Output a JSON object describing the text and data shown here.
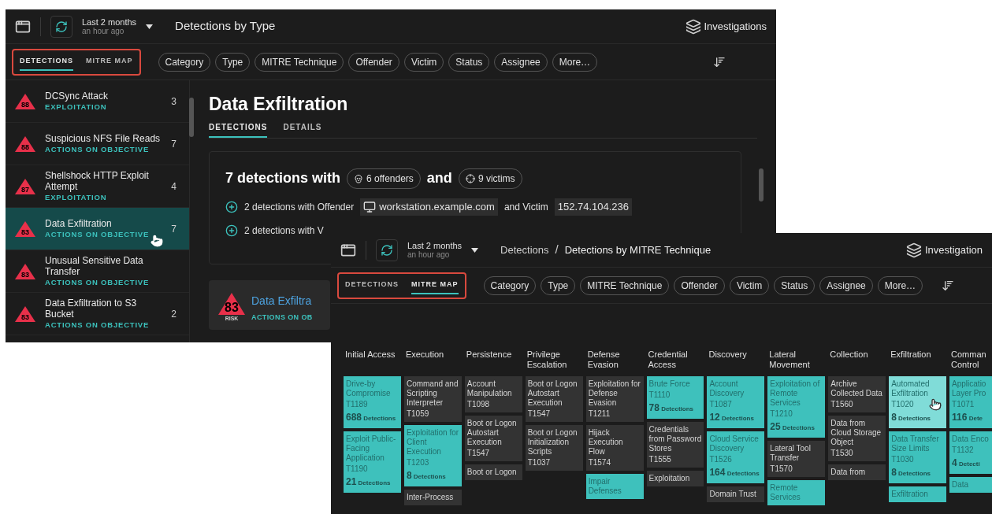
{
  "detections_window": {
    "time_range": {
      "label": "Last 2 months",
      "updated": "an hour ago"
    },
    "title": "Detections by Type",
    "header_link": "Investigations",
    "view_tabs": [
      {
        "label": "DETECTIONS",
        "selected": true
      },
      {
        "label": "MITRE MAP",
        "selected": false
      }
    ],
    "filters": [
      "Category",
      "Type",
      "MITRE Technique",
      "Offender",
      "Victim",
      "Status",
      "Assignee",
      "More…"
    ],
    "sidebar": {
      "items": [
        {
          "name": "DCSync Attack",
          "category": "EXPLOITATION",
          "risk": "88",
          "count": "3",
          "selected": false,
          "pointer": false
        },
        {
          "name": "Suspicious NFS File Reads",
          "category": "ACTIONS ON OBJECTIVE",
          "risk": "88",
          "count": "7",
          "selected": false,
          "pointer": false
        },
        {
          "name": "Shellshock HTTP Exploit Attempt",
          "category": "EXPLOITATION",
          "risk": "87",
          "count": "4",
          "selected": false,
          "pointer": false
        },
        {
          "name": "Data Exfiltration",
          "category": "ACTIONS ON OBJECTIVE",
          "risk": "83",
          "count": "7",
          "selected": true,
          "pointer": true
        },
        {
          "name": "Unusual Sensitive Data Transfer",
          "category": "ACTIONS ON OBJECTIVE",
          "risk": "83",
          "selected": false,
          "pointer": false
        },
        {
          "name": "Data Exfiltration to S3 Bucket",
          "category": "ACTIONS ON OBJECTIVE",
          "risk": "83",
          "count": "2",
          "selected": false,
          "pointer": false
        }
      ]
    },
    "detail": {
      "title": "Data Exfiltration",
      "tabs": [
        {
          "label": "DETECTIONS",
          "selected": true
        },
        {
          "label": "DETAILS",
          "selected": false
        }
      ],
      "summary": {
        "lead": "7 detections with",
        "offenders": "6 offenders",
        "joiner": "and",
        "victims": "9 victims"
      },
      "groups": [
        {
          "prefix": "2 detections with Offender",
          "offender": "workstation.example.com",
          "joiner": "and Victim",
          "victim": "152.74.104.236"
        },
        {
          "prefix": "2 detections with V"
        }
      ],
      "card": {
        "risk": "83",
        "risk_label": "RISK",
        "title": "Data Exfiltra",
        "category": "ACTIONS ON OB"
      }
    }
  },
  "mitre_window": {
    "time_range": {
      "label": "Last 2 months",
      "updated": "an hour ago"
    },
    "breadcrumb": [
      "Detections",
      "Detections by MITRE Technique"
    ],
    "breadcrumb_separator": "/",
    "header_link": "Investigation",
    "view_tabs": [
      {
        "label": "DETECTIONS",
        "selected": false
      },
      {
        "label": "MITRE MAP",
        "selected": true
      }
    ],
    "filters": [
      "Category",
      "Type",
      "MITRE Technique",
      "Offender",
      "Victim",
      "Status",
      "Assignee",
      "More…"
    ],
    "tactics": [
      {
        "name": "Initial Access",
        "techniques": [
          {
            "name": "Drive-by Compromise",
            "id": "T1189",
            "count": "688",
            "count_label": "Detections",
            "detected": true,
            "pointer": false
          },
          {
            "name": "Exploit Public-Facing Application",
            "id": "T1190",
            "count": "21",
            "count_label": "Detections",
            "detected": true,
            "pointer": false
          }
        ]
      },
      {
        "name": "Execution",
        "techniques": [
          {
            "name": "Command and Scripting Interpreter",
            "id": "T1059",
            "detected": false,
            "pointer": false
          },
          {
            "name": "Exploitation for Client Execution",
            "id": "T1203",
            "count": "8",
            "count_label": "Detections",
            "detected": true,
            "pointer": false
          },
          {
            "name": "Inter-Process",
            "detected": false,
            "pointer": false
          }
        ]
      },
      {
        "name": "Persistence",
        "techniques": [
          {
            "name": "Account Manipulation",
            "id": "T1098",
            "detected": false,
            "pointer": false
          },
          {
            "name": "Boot or Logon Autostart Execution",
            "id": "T1547",
            "detected": false,
            "pointer": false
          },
          {
            "name": "Boot or Logon",
            "detected": false,
            "pointer": false
          }
        ]
      },
      {
        "name": "Privilege Escalation",
        "techniques": [
          {
            "name": "Boot or Logon Autostart Execution",
            "id": "T1547",
            "detected": false,
            "pointer": false
          },
          {
            "name": "Boot or Logon Initialization Scripts",
            "id": "T1037",
            "detected": false,
            "pointer": false
          }
        ]
      },
      {
        "name": "Defense Evasion",
        "techniques": [
          {
            "name": "Exploitation for Defense Evasion",
            "id": "T1211",
            "detected": false,
            "pointer": false
          },
          {
            "name": "Hijack Execution Flow",
            "id": "T1574",
            "detected": false,
            "pointer": false
          },
          {
            "name": "Impair Defenses",
            "detected": true,
            "pointer": false
          }
        ]
      },
      {
        "name": "Credential Access",
        "techniques": [
          {
            "name": "Brute Force",
            "id": "T1110",
            "count": "78",
            "count_label": "Detections",
            "detected": true,
            "pointer": false
          },
          {
            "name": "Credentials from Password Stores",
            "id": "T1555",
            "detected": false,
            "pointer": false
          },
          {
            "name": "Exploitation",
            "detected": false,
            "pointer": false
          }
        ]
      },
      {
        "name": "Discovery",
        "techniques": [
          {
            "name": "Account Discovery",
            "id": "T1087",
            "count": "12",
            "count_label": "Detections",
            "detected": true,
            "pointer": false
          },
          {
            "name": "Cloud Service Discovery",
            "id": "T1526",
            "count": "164",
            "count_label": "Detections",
            "detected": true,
            "pointer": false
          },
          {
            "name": "Domain Trust",
            "detected": false,
            "pointer": false
          }
        ]
      },
      {
        "name": "Lateral Movement",
        "techniques": [
          {
            "name": "Exploitation of Remote Services",
            "id": "T1210",
            "count": "25",
            "count_label": "Detections",
            "detected": true,
            "pointer": false
          },
          {
            "name": "Lateral Tool Transfer",
            "id": "T1570",
            "detected": false,
            "pointer": false
          },
          {
            "name": "Remote Services",
            "detected": true,
            "pointer": false
          }
        ]
      },
      {
        "name": "Collection",
        "techniques": [
          {
            "name": "Archive Collected Data",
            "id": "T1560",
            "detected": false,
            "pointer": false
          },
          {
            "name": "Data from Cloud Storage Object",
            "id": "T1530",
            "detected": false,
            "pointer": false
          },
          {
            "name": "Data from",
            "detected": false,
            "pointer": false
          }
        ]
      },
      {
        "name": "Exfiltration",
        "techniques": [
          {
            "name": "Automated Exfiltration",
            "id": "T1020",
            "count": "8",
            "count_label": "Detections",
            "detected": true,
            "pointer": true
          },
          {
            "name": "Data Transfer Size Limits",
            "id": "T1030",
            "count": "8",
            "count_label": "Detections",
            "detected": true,
            "pointer": false
          },
          {
            "name": "Exfiltration",
            "detected": true,
            "pointer": false
          }
        ]
      },
      {
        "name": "Comman Control",
        "techniques": [
          {
            "name": "Applicatio Layer Pro",
            "id": "T1071",
            "count": "116",
            "count_label": "Dete",
            "detected": true,
            "pointer": false
          },
          {
            "name": "Data Enco",
            "id": "T1132",
            "count": "4",
            "count_label": "Detecti",
            "detected": true,
            "pointer": false
          },
          {
            "name": "Data",
            "detected": true,
            "pointer": false
          }
        ]
      }
    ]
  }
}
